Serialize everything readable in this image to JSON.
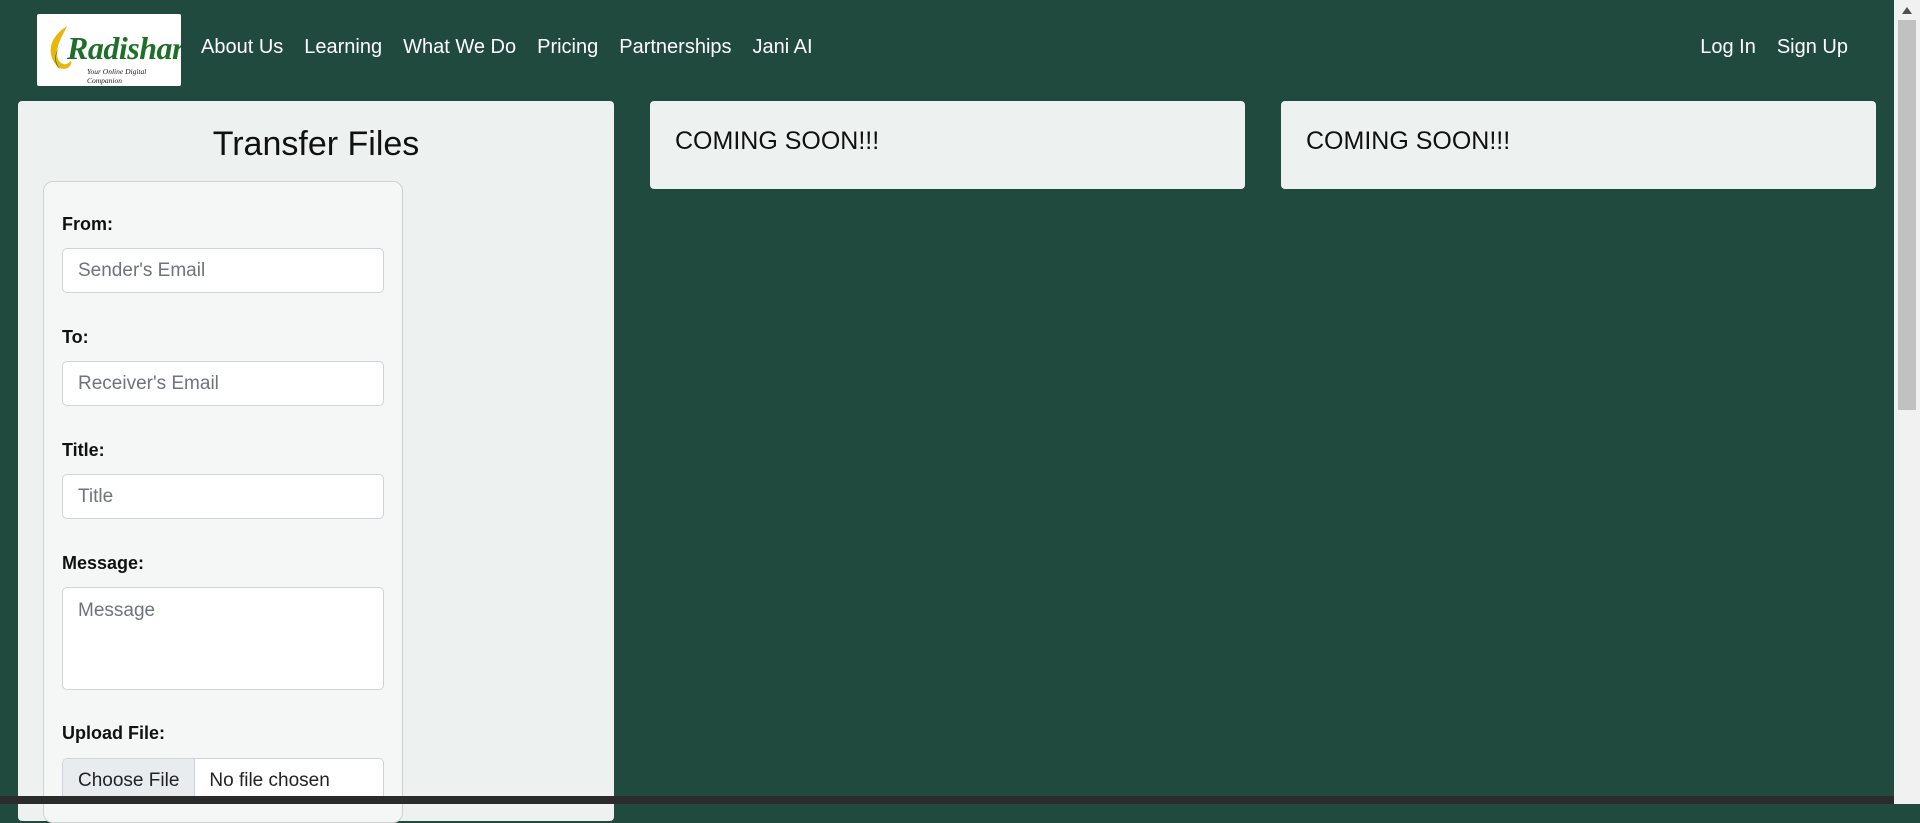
{
  "brand": {
    "name": "Radishare",
    "tagline": "Your Online Digital Companion"
  },
  "nav": {
    "links": [
      "About Us",
      "Learning",
      "What We Do",
      "Pricing",
      "Partnerships",
      "Jani AI"
    ],
    "login": "Log In",
    "signup": "Sign Up"
  },
  "transfer": {
    "title": "Transfer Files",
    "from_label": "From:",
    "from_placeholder": "Sender's Email",
    "to_label": "To:",
    "to_placeholder": "Receiver's Email",
    "title_label": "Title:",
    "title_placeholder": "Title",
    "message_label": "Message:",
    "message_placeholder": "Message",
    "upload_label": "Upload File:",
    "choose_file": "Choose File",
    "file_status": "No file chosen"
  },
  "cards": {
    "card1": "COMING SOON!!!",
    "card2": "COMING SOON!!!"
  },
  "colors": {
    "background": "#214a3f",
    "card": "#edf2f0",
    "logo_text": "#1f6f2a",
    "logo_swoosh": "#e8b70c"
  },
  "icons": {
    "logo": "radishare-logo",
    "resize": "resize-grip-icon",
    "scroll_up": "scroll-up-arrow-icon"
  }
}
